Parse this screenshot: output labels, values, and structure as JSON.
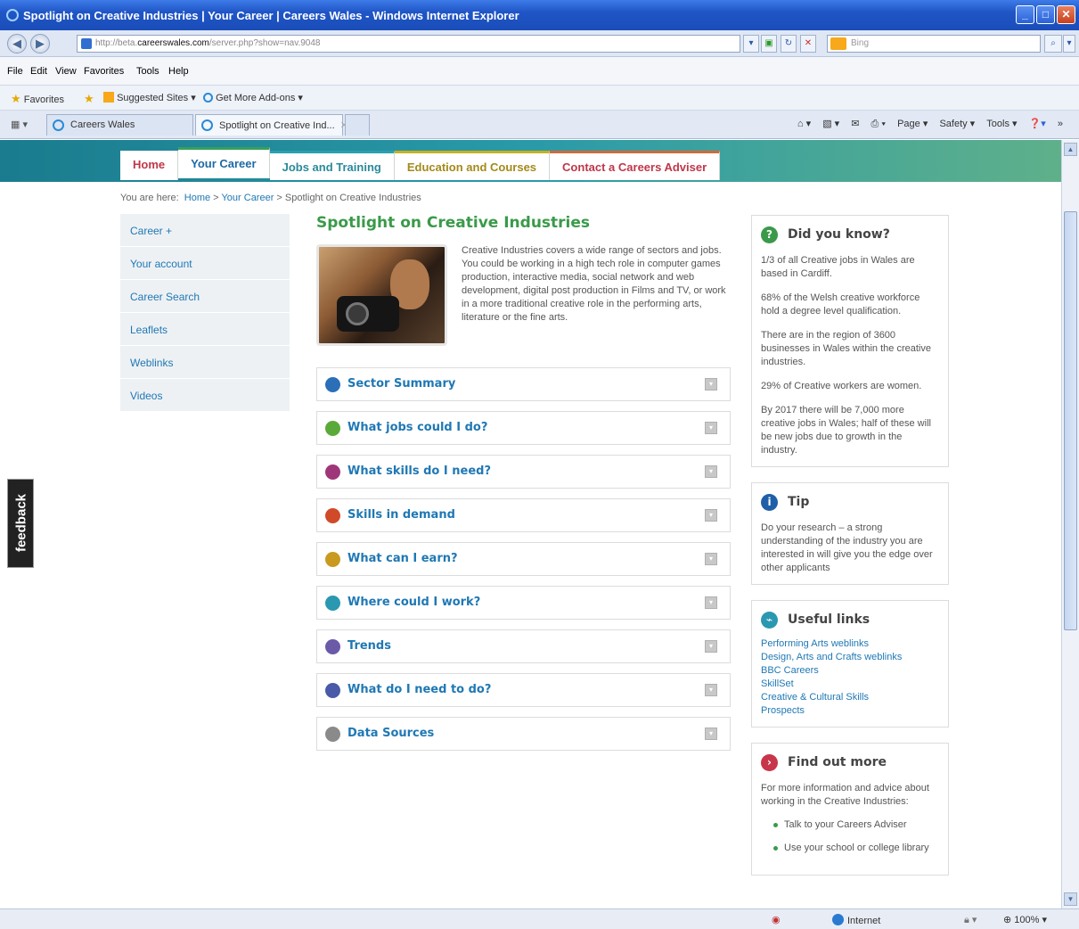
{
  "window": {
    "title": "Spotlight on Creative Industries | Your Career | Careers Wales - Windows Internet Explorer",
    "min": "_",
    "max": "□",
    "close": "✕"
  },
  "address": {
    "url_prefix": "http://beta.",
    "url_domain": "careerswales.com",
    "url_path": "/server.php?show=nav.9048",
    "search_placeholder": "Bing"
  },
  "menu": [
    "File",
    "Edit",
    "View",
    "Favorites",
    "Tools",
    "Help"
  ],
  "favorites": {
    "label": "Favorites",
    "suggested": "Suggested Sites ▾",
    "addons": "Get More Add-ons ▾"
  },
  "tabs": [
    {
      "label": "Careers Wales"
    },
    {
      "label": "Spotlight on Creative Ind...",
      "close": "✕"
    }
  ],
  "commandbar": {
    "page": "Page ▾",
    "safety": "Safety ▾",
    "tools": "Tools ▾",
    "more": "»"
  },
  "site_nav": {
    "home": "Home",
    "career": "Your Career",
    "jobs": "Jobs and Training",
    "education": "Education and Courses",
    "contact": "Contact a Careers Adviser"
  },
  "breadcrumb": {
    "prefix": "You are here:",
    "home": "Home",
    "sep1": " > ",
    "career": "Your Career",
    "sep2": " > ",
    "current": "Spotlight on Creative Industries"
  },
  "sidenav": [
    "Career +",
    "Your account",
    "Career Search",
    "Leaflets",
    "Weblinks",
    "Videos"
  ],
  "main": {
    "title": "Spotlight on Creative Industries",
    "intro": "Creative Industries covers a wide range of sectors and jobs. You could be working in a high tech role in computer games production, interactive media, social network and web development, digital post production in Films and TV, or work in a more traditional creative role in the performing arts, literature or the fine arts.",
    "sections": [
      {
        "label": "Sector Summary",
        "icon": "list-icon",
        "color": "#2a6fb8"
      },
      {
        "label": "What jobs could I do?",
        "icon": "briefcase-icon",
        "color": "#5aaa3a"
      },
      {
        "label": "What skills do I need?",
        "icon": "pencil-icon",
        "color": "#a0367a"
      },
      {
        "label": "Skills in demand",
        "icon": "alert-icon",
        "color": "#d04a2a"
      },
      {
        "label": "What can I earn?",
        "icon": "pound-icon",
        "color": "#c89a20"
      },
      {
        "label": "Where could I work?",
        "icon": "building-icon",
        "color": "#2a98b0"
      },
      {
        "label": "Trends",
        "icon": "trends-icon",
        "color": "#6a5aa8"
      },
      {
        "label": "What do I need to do?",
        "icon": "checklist-icon",
        "color": "#4a5aa8"
      },
      {
        "label": "Data Sources",
        "icon": "magnifier-icon",
        "color": "#8a8a8a"
      }
    ],
    "toggle": "▾"
  },
  "did_you_know": {
    "title": "Did you know?",
    "facts": [
      "1/3 of all Creative jobs in Wales are based in Cardiff.",
      "68% of the Welsh creative workforce hold a degree level qualification.",
      "There are in the region of 3600 businesses in Wales within the creative industries.",
      "29% of Creative workers are women.",
      "By 2017 there will be 7,000 more creative jobs in Wales; half of these will be new jobs due to growth in the industry."
    ]
  },
  "tip": {
    "title": "Tip",
    "text": "Do your research – a strong understanding of the industry you are interested in will give you the edge over other applicants"
  },
  "useful_links": {
    "title": "Useful links",
    "links": [
      "Performing Arts weblinks",
      "Design, Arts and Crafts weblinks",
      "BBC Careers",
      "SkillSet",
      "Creative & Cultural Skills",
      "Prospects"
    ]
  },
  "find_out_more": {
    "title": "Find out more",
    "text": "For more information and advice about working in the Creative Industries:",
    "items": [
      "Talk to your Careers Adviser",
      "Use your school or college library"
    ]
  },
  "feedback": "feedback",
  "status": {
    "zone": "Internet",
    "zoom": "100%"
  },
  "colors": {
    "title_green": "#3a9a4a",
    "link_blue": "#1f78b4",
    "header_teal": "#1a7c8e"
  }
}
